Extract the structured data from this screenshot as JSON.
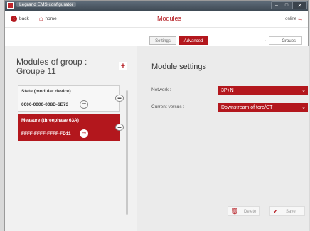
{
  "window": {
    "title": "Legrand  EMS configurator",
    "controls": {
      "minimize": "–",
      "maximize": "□",
      "close": "✕"
    }
  },
  "nav": {
    "back": "back",
    "home": "home",
    "title": "Modules",
    "status": "online"
  },
  "tabs": [
    {
      "label": "Settings",
      "active": false
    },
    {
      "label": "Advanced",
      "active": true
    }
  ],
  "groups_button": "Groups",
  "left": {
    "title_line1": "Modules of group :",
    "title_line2": "Groupe  11",
    "add_symbol": "+",
    "devices": [
      {
        "name": "State (modular device)",
        "serial": "0000-0000-008D-6E73",
        "selected": false
      },
      {
        "name": "Measure (threephase 63A)",
        "serial": "FFFF-FFFF-FFFF-FD11",
        "selected": true
      }
    ]
  },
  "right": {
    "title": "Module settings",
    "fields": [
      {
        "label": "Network :",
        "value": "3P+N"
      },
      {
        "label": "Current versus :",
        "value": "Downstream of tore/CT"
      }
    ],
    "delete_label": "Delete",
    "save_label": "Save"
  },
  "colors": {
    "accent": "#b3171d",
    "titlebar": "#4b5661",
    "panel_left": "#f1f1f1",
    "panel_right": "#ebebeb"
  }
}
